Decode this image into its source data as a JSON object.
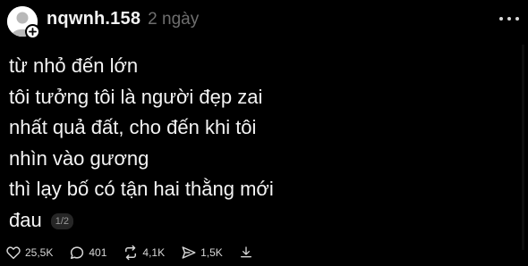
{
  "post": {
    "author": {
      "username": "nqwnh.158",
      "time": "2 ngày"
    },
    "body_lines": [
      "từ nhỏ đến lớn",
      "tôi tưởng tôi là người đẹp zai",
      "nhất quả đất, cho đến khi tôi",
      "nhìn vào gương",
      "thì lạy bố có tận hai thằng mới",
      "đau"
    ],
    "page_indicator": "1/2",
    "actions": {
      "likes": "25,5K",
      "comments": "401",
      "reposts": "4,1K",
      "shares": "1,5K"
    },
    "icons": {
      "avatar": "default-avatar-icon",
      "follow": "plus-icon",
      "more": "more-dots-icon",
      "like": "heart-icon",
      "comment": "comment-bubble-icon",
      "repost": "repost-icon",
      "share": "share-icon",
      "save": "download-icon"
    }
  }
}
